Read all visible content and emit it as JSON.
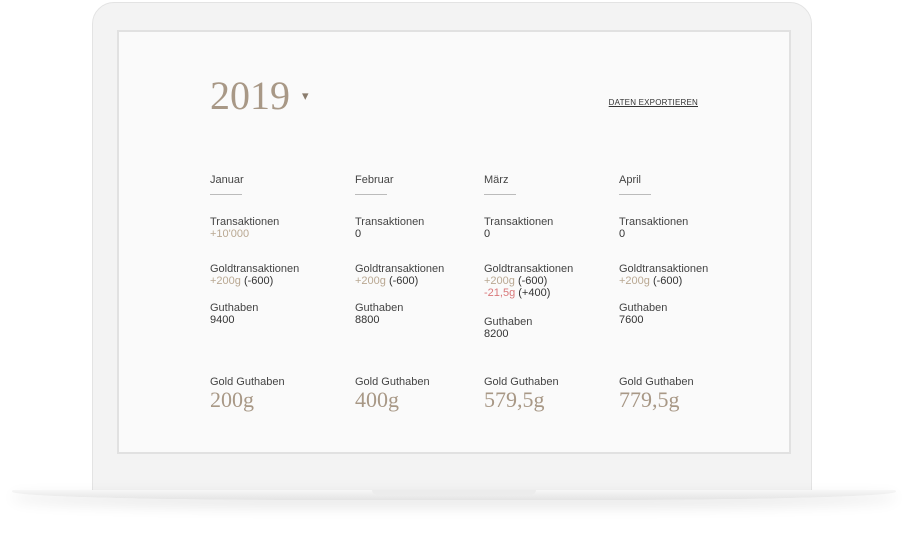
{
  "header": {
    "year": "2019",
    "caret": "▾",
    "export_label": "DATEN EXPORTIEREN"
  },
  "labels": {
    "transactions": "Transaktionen",
    "gold_transactions": "Goldtransaktionen",
    "balance": "Guthaben",
    "gold_balance": "Gold Guthaben"
  },
  "colors": {
    "accent_gold": "#a89886",
    "gold_light": "#b9a892",
    "negative": "#d9787a"
  },
  "months": [
    {
      "name": "Januar",
      "transactions": "+10'000",
      "gold_transactions": [
        {
          "amount": "+200g",
          "note": "(-600)",
          "negative": false
        }
      ],
      "balance": "9400",
      "gold_balance": "200g"
    },
    {
      "name": "Februar",
      "transactions": "0",
      "gold_transactions": [
        {
          "amount": "+200g",
          "note": "(-600)",
          "negative": false
        }
      ],
      "balance": "8800",
      "gold_balance": "400g"
    },
    {
      "name": "März",
      "transactions": "0",
      "gold_transactions": [
        {
          "amount": "+200g",
          "note": "(-600)",
          "negative": false
        },
        {
          "amount": "-21,5g",
          "note": "(+400)",
          "negative": true
        }
      ],
      "balance": "8200",
      "gold_balance": "579,5g"
    },
    {
      "name": "April",
      "transactions": "0",
      "gold_transactions": [
        {
          "amount": "+200g",
          "note": "(-600)",
          "negative": false
        }
      ],
      "balance": "7600",
      "gold_balance": "779,5g"
    }
  ]
}
